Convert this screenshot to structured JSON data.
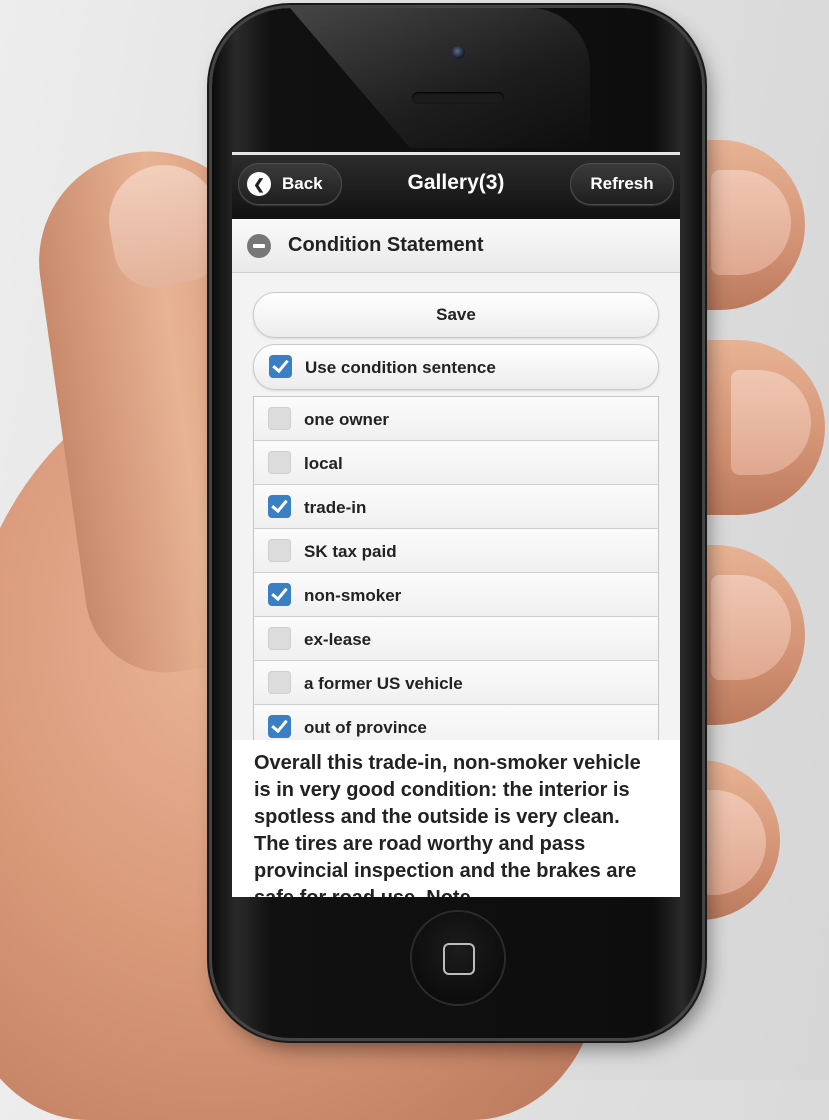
{
  "header": {
    "title": "Gallery(3)",
    "back_label": "Back",
    "refresh_label": "Refresh"
  },
  "section": {
    "title": "Condition Statement",
    "save_label": "Save",
    "use_sentence": {
      "label": "Use condition sentence",
      "checked": true
    }
  },
  "options": [
    {
      "label": "one owner",
      "checked": false
    },
    {
      "label": "local",
      "checked": false
    },
    {
      "label": "trade-in",
      "checked": true
    },
    {
      "label": "SK tax paid",
      "checked": false
    },
    {
      "label": "non-smoker",
      "checked": true
    },
    {
      "label": "ex-lease",
      "checked": false
    },
    {
      "label": "a former US vehicle",
      "checked": false
    },
    {
      "label": "out of province",
      "checked": true
    }
  ],
  "summary_text": "Overall this trade-in, non-smoker vehicle is in very good condition: the interior is spotless and the outside is very clean. The tires are road worthy and pass provincial inspection and the brakes are safe for road use. Note",
  "colors": {
    "accent": "#3a7fc4",
    "header": "#1a1a1a"
  }
}
